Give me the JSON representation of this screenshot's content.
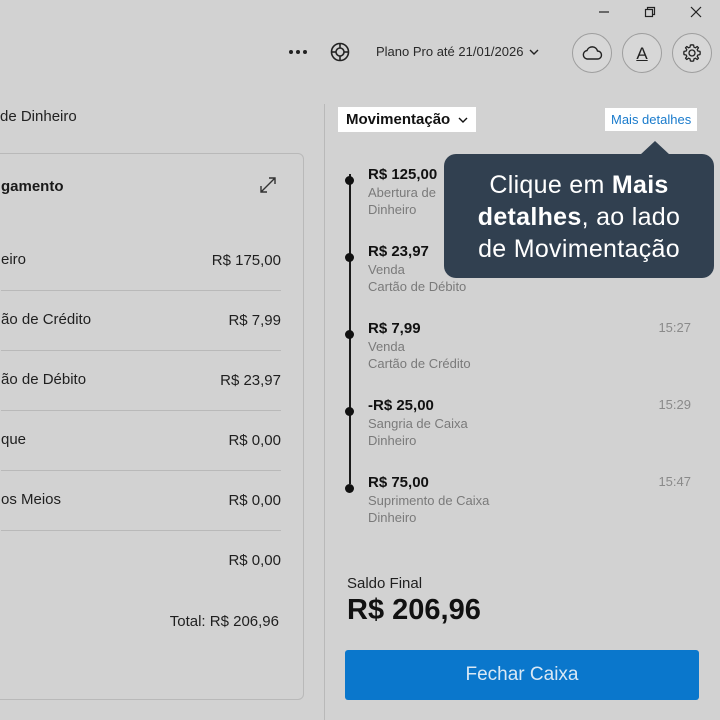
{
  "window_controls": {
    "minimize_icon": "minimize-icon",
    "restore_icon": "restore-icon",
    "close_icon": "close-icon"
  },
  "toolbar": {
    "more_icon": "more-horizontal-icon",
    "help_icon": "lifebuoy-icon",
    "plan_label": "Plano Pro até 21/01/2026",
    "cloud_icon": "cloud-icon",
    "font_icon": "font-icon",
    "font_glyph": "A",
    "settings_icon": "gear-icon"
  },
  "left_panel": {
    "title": "de Dinheiro",
    "card_title": "gamento",
    "rows": [
      {
        "label": "eiro",
        "value": "R$ 175,00"
      },
      {
        "label": "ão de Crédito",
        "value": "R$ 7,99"
      },
      {
        "label": "ão de Débito",
        "value": "R$ 23,97"
      },
      {
        "label": "que",
        "value": "R$ 0,00"
      },
      {
        "label": "os Meios",
        "value": "R$ 0,00"
      },
      {
        "label": "",
        "value": "R$ 0,00"
      }
    ],
    "total_label": "Total:",
    "total_value": "R$ 206,96"
  },
  "right_panel": {
    "select_label": "Movimentação",
    "details_link": "Mais detalhes",
    "movements": [
      {
        "amount": "R$ 125,00",
        "description": "Abertura de",
        "method": "Dinheiro",
        "time": ""
      },
      {
        "amount": "R$ 23,97",
        "description": "Venda",
        "method": "Cartão de Débito",
        "time": ""
      },
      {
        "amount": "R$ 7,99",
        "description": "Venda",
        "method": "Cartão de Crédito",
        "time": "15:27"
      },
      {
        "amount": "-R$ 25,00",
        "description": "Sangria de Caixa",
        "method": "Dinheiro",
        "time": "15:29"
      },
      {
        "amount": "R$ 75,00",
        "description": "Suprimento de Caixa",
        "method": "Dinheiro",
        "time": "15:47"
      }
    ],
    "saldo_label": "Saldo Final",
    "saldo_value": "R$ 206,96",
    "close_button": "Fechar Caixa"
  },
  "tooltip": {
    "part1": "Clique em ",
    "bold1": "Mais",
    "bold2": "detalhes",
    "part2": ", ao lado",
    "line3": "de Movimentação"
  },
  "colors": {
    "background": "#d2d2d2",
    "accent": "#0a77cc",
    "link": "#1a7bcc",
    "tooltip_bg": "#314050"
  }
}
